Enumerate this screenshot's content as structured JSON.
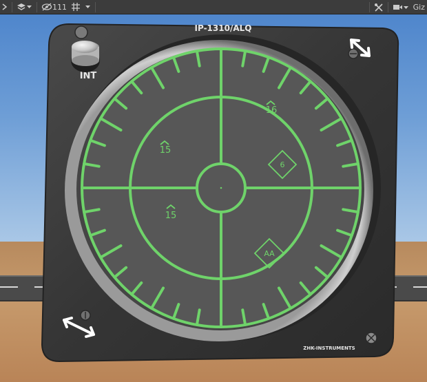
{
  "toolbar": {
    "counter": "111",
    "gizmos_label": "Giz"
  },
  "instrument": {
    "title": "IP-1310/ALQ",
    "knob_label": "INT",
    "brand": "ZHK-INSTRUMENTS",
    "symbols": [
      {
        "label": "16",
        "shape": "threat-hat"
      },
      {
        "label": "15",
        "shape": "threat-hat"
      },
      {
        "label": "15",
        "shape": "threat-hat"
      },
      {
        "label": "6",
        "shape": "diamond"
      },
      {
        "label": "AA",
        "shape": "diamond"
      }
    ]
  },
  "colors": {
    "scope_green": "#6fd36a",
    "panel_dark": "#3a3a3a",
    "screen": "#575757"
  },
  "icons": [
    "chevron-down-icon",
    "visibility-icon",
    "grid-icon",
    "tools-icon",
    "camera-icon",
    "move-arrow-icon",
    "screw-icon"
  ]
}
